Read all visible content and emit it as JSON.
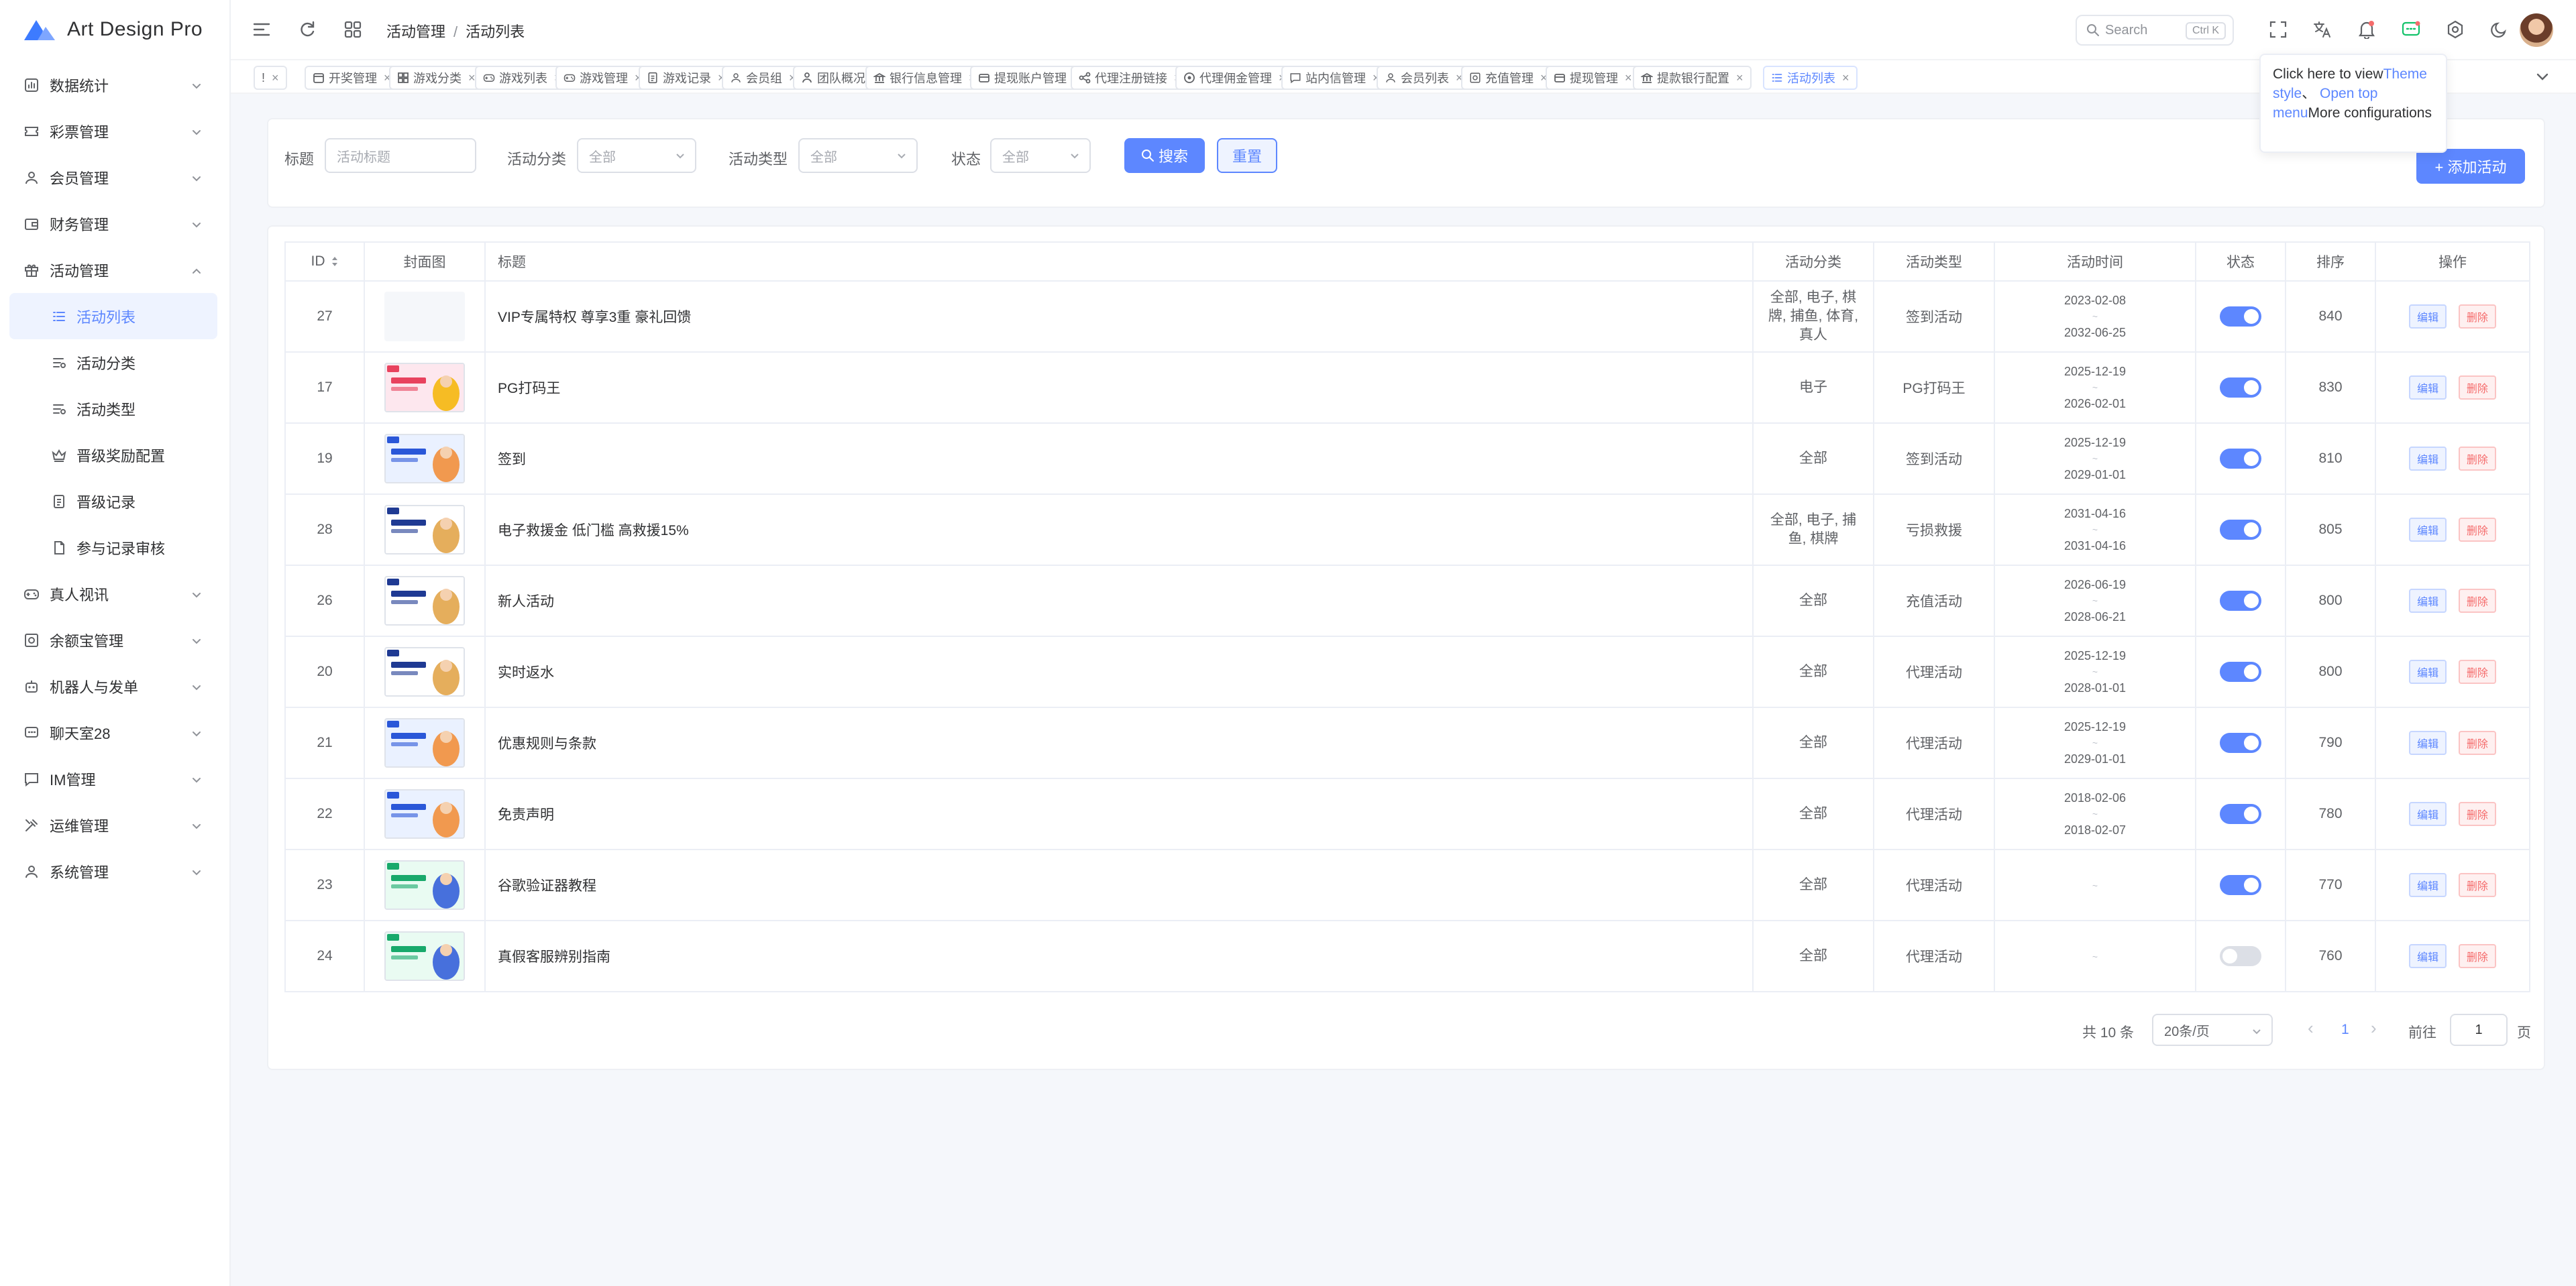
{
  "app": {
    "name": "Art Design Pro"
  },
  "colors": {
    "accent": "#5d87ff",
    "danger": "#f56c6c",
    "text": "#303133",
    "muted": "#909399"
  },
  "sidebar": {
    "items": [
      {
        "label": "数据统计",
        "icon": "chart-icon"
      },
      {
        "label": "彩票管理",
        "icon": "ticket-icon"
      },
      {
        "label": "会员管理",
        "icon": "user-icon"
      },
      {
        "label": "财务管理",
        "icon": "wallet-icon"
      },
      {
        "label": "活动管理",
        "icon": "gift-icon",
        "expanded": true,
        "children": [
          {
            "label": "活动列表",
            "icon": "list-icon",
            "active": true
          },
          {
            "label": "活动分类",
            "icon": "category-icon"
          },
          {
            "label": "活动类型",
            "icon": "category-icon"
          },
          {
            "label": "晋级奖励配置",
            "icon": "crown-icon"
          },
          {
            "label": "晋级记录",
            "icon": "document-icon"
          },
          {
            "label": "参与记录审核",
            "icon": "audit-icon"
          }
        ]
      },
      {
        "label": "真人视讯",
        "icon": "gamepad-icon"
      },
      {
        "label": "余额宝管理",
        "icon": "safe-icon"
      },
      {
        "label": "机器人与发单",
        "icon": "robot-icon"
      },
      {
        "label": "聊天室28",
        "icon": "chat-icon"
      },
      {
        "label": "IM管理",
        "icon": "message-icon"
      },
      {
        "label": "运维管理",
        "icon": "tools-icon"
      },
      {
        "label": "系统管理",
        "icon": "user-icon"
      }
    ]
  },
  "header": {
    "breadcrumb": [
      "活动管理",
      "活动列表"
    ],
    "search_placeholder": "Search",
    "search_shortcut": "Ctrl K"
  },
  "tabs": [
    {
      "label": "!",
      "icon": ""
    },
    {
      "label": "开奖管理",
      "icon": "calendar-icon"
    },
    {
      "label": "游戏分类",
      "icon": "grid-icon"
    },
    {
      "label": "游戏列表",
      "icon": "gamepad-icon"
    },
    {
      "label": "游戏管理",
      "icon": "gamepad-icon"
    },
    {
      "label": "游戏记录",
      "icon": "document-icon"
    },
    {
      "label": "会员组",
      "icon": "user-icon"
    },
    {
      "label": "团队概况",
      "icon": "team-icon"
    },
    {
      "label": "银行信息管理",
      "icon": "bank-icon"
    },
    {
      "label": "提现账户管理",
      "icon": "card-icon"
    },
    {
      "label": "代理注册链接",
      "icon": "share-icon"
    },
    {
      "label": "代理佣金管理",
      "icon": "coin-icon"
    },
    {
      "label": "站内信管理",
      "icon": "message-icon"
    },
    {
      "label": "会员列表",
      "icon": "user-icon"
    },
    {
      "label": "充值管理",
      "icon": "safe-icon"
    },
    {
      "label": "提现管理",
      "icon": "card-icon"
    },
    {
      "label": "提款银行配置",
      "icon": "bank-icon"
    },
    {
      "label": "活动列表",
      "icon": "list-icon",
      "active": true
    }
  ],
  "tooltip": {
    "part1": "Click here to view",
    "link1": "Theme style",
    "part2": "、",
    "link2": "Open top menu",
    "part3": "More configurations"
  },
  "filters": {
    "title_label": "标题",
    "title_placeholder": "活动标题",
    "category_label": "活动分类",
    "category_value": "全部",
    "type_label": "活动类型",
    "type_value": "全部",
    "status_label": "状态",
    "status_value": "全部",
    "search_button": "搜索",
    "reset_button": "重置",
    "add_button": "+ 添加活动"
  },
  "table": {
    "columns": [
      "ID",
      "封面图",
      "标题",
      "活动分类",
      "活动类型",
      "活动时间",
      "状态",
      "排序",
      "操作"
    ],
    "edit_label": "编辑",
    "delete_label": "删除",
    "rows": [
      {
        "id": "27",
        "cover": "blank",
        "title": "VIP专属特权 尊享3重 豪礼回馈",
        "category": "全部, 电子, 棋牌, 捕鱼, 体育, 真人",
        "type": "签到活动",
        "start": "2023-02-08",
        "end": "2032-06-25",
        "enabled": true,
        "sort": "840"
      },
      {
        "id": "17",
        "cover": "pink",
        "title": "PG打码王",
        "category": "电子",
        "type": "PG打码王",
        "start": "2025-12-19",
        "end": "2026-02-01",
        "enabled": true,
        "sort": "830"
      },
      {
        "id": "19",
        "cover": "blue",
        "title": "签到",
        "category": "全部",
        "type": "签到活动",
        "start": "2025-12-19",
        "end": "2029-01-01",
        "enabled": true,
        "sort": "810"
      },
      {
        "id": "28",
        "cover": "white",
        "title": "电子救援金 低门槛 高救援15%",
        "category": "全部, 电子, 捕鱼, 棋牌",
        "type": "亏损救援",
        "start": "2031-04-16",
        "end": "2031-04-16",
        "enabled": true,
        "sort": "805"
      },
      {
        "id": "26",
        "cover": "white",
        "title": "新人活动",
        "category": "全部",
        "type": "充值活动",
        "start": "2026-06-19",
        "end": "2028-06-21",
        "enabled": true,
        "sort": "800"
      },
      {
        "id": "20",
        "cover": "white",
        "title": "实时返水",
        "category": "全部",
        "type": "代理活动",
        "start": "2025-12-19",
        "end": "2028-01-01",
        "enabled": true,
        "sort": "800"
      },
      {
        "id": "21",
        "cover": "blue",
        "title": "优惠规则与条款",
        "category": "全部",
        "type": "代理活动",
        "start": "2025-12-19",
        "end": "2029-01-01",
        "enabled": true,
        "sort": "790"
      },
      {
        "id": "22",
        "cover": "blue",
        "title": "免责声明",
        "category": "全部",
        "type": "代理活动",
        "start": "2018-02-06",
        "end": "2018-02-07",
        "enabled": true,
        "sort": "780"
      },
      {
        "id": "23",
        "cover": "green",
        "title": "谷歌验证器教程",
        "category": "全部",
        "type": "代理活动",
        "start": "",
        "end": "",
        "enabled": true,
        "sort": "770"
      },
      {
        "id": "24",
        "cover": "green",
        "title": "真假客服辨别指南",
        "category": "全部",
        "type": "代理活动",
        "start": "",
        "end": "",
        "enabled": false,
        "sort": "760"
      }
    ]
  },
  "pagination": {
    "total": "共 10 条",
    "page_size": "20条/页",
    "prev": "‹",
    "current": "1",
    "next": "›",
    "goto_label": "前往",
    "goto_value": "1",
    "page_suffix": "页"
  }
}
